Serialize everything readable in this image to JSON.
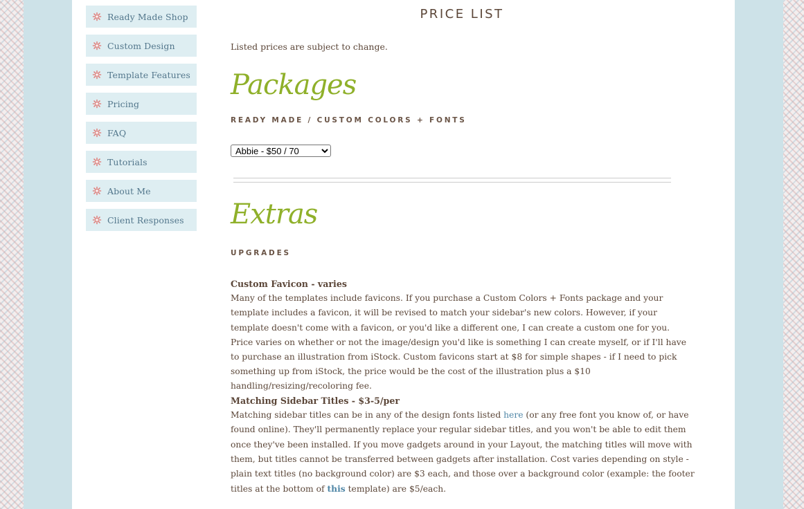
{
  "sidebar": {
    "items": [
      {
        "label": "Ready Made Shop"
      },
      {
        "label": "Custom Design"
      },
      {
        "label": "Template Features"
      },
      {
        "label": "Pricing"
      },
      {
        "label": "FAQ"
      },
      {
        "label": "Tutorials"
      },
      {
        "label": "About Me"
      },
      {
        "label": "Client Responses"
      }
    ],
    "icon": "asterisk-flower-icon",
    "icon_color": "#e0837f",
    "item_bg": "#deeef2"
  },
  "main": {
    "title": "PRICE LIST",
    "notice": "Listed prices are subject to change.",
    "packages": {
      "heading": "Packages",
      "subheading": "READY MADE / CUSTOM COLORS + FONTS",
      "select_value": "Abbie - $50 / 70"
    },
    "extras": {
      "heading": "Extras",
      "subheading": "UPGRADES",
      "favicon": {
        "title": "Custom Favicon - varies",
        "body": "Many of the templates include favicons. If you purchase a Custom Colors + Fonts package and your template includes a favicon, it will be revised to match your sidebar's new colors. However, if your template doesn't come with a favicon, or you'd like a different one, I can create a custom one for you. Price varies on whether or not the image/design you'd like is something I can create myself, or if I'll have to purchase an illustration from iStock. Custom favicons start at $8 for simple shapes - if I need to pick something up from iStock, the price would be the cost of the illustration plus a $10 handling/resizing/recoloring fee."
      },
      "sidebar_titles": {
        "title": "Matching Sidebar Titles - $3-5/per",
        "body_1": "Matching sidebar titles can be in any of the design fonts listed ",
        "link_1": "here",
        "body_2": " (or any free font you know of, or have found online). They'll permanently replace your regular sidebar titles, and you won't be able to edit them once they've been installed. If you move gadgets around in your Layout, the matching titles will move with them, but titles cannot be transferred between gadgets after installation. Cost varies depending on style - plain text titles (no background color) are $3 each, and those over a background color (example: the footer titles at the bottom of ",
        "link_2": "this",
        "body_3": " template) are $5/each."
      }
    }
  },
  "colors": {
    "accent_green": "#8fb02a",
    "text_brown": "#5b4638",
    "link_blue": "#4f86a6",
    "band_blue": "#cde2e8"
  }
}
